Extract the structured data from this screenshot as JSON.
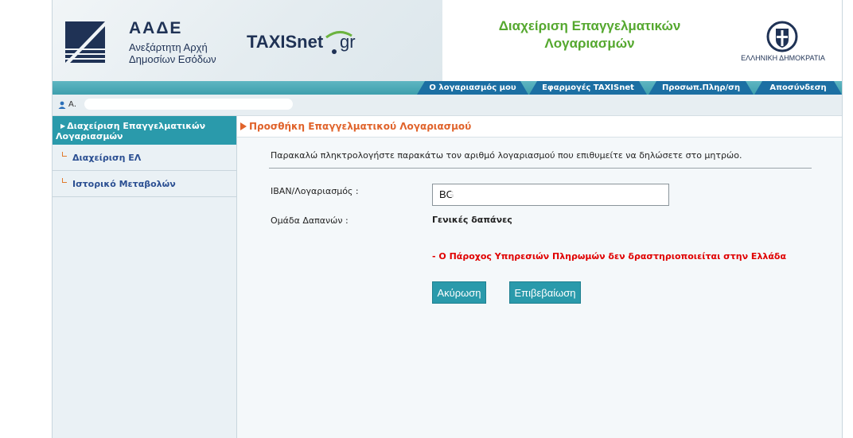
{
  "header": {
    "agency_acronym": "ΑΑΔΕ",
    "agency_name_line1": "Ανεξάρτητη Αρχή",
    "agency_name_line2": "Δημοσίων Εσόδων",
    "taxisnet_main": "TAXISnet",
    "taxisnet_suffix": "gr",
    "title_line1": "Διαχείριση Επαγγελματικών",
    "title_line2": "Λογαριασμών",
    "gov_label": "ΕΛΛΗΝΙΚΗ ΔΗΜΟΚΡΑΤΙΑ",
    "title_color": "#55a82f",
    "brand_color": "#1f3255"
  },
  "nav": {
    "items": [
      {
        "label": "Ο λογαριασμός μου"
      },
      {
        "label": "Εφαρμογές TAXISnet"
      },
      {
        "label": "Προσωπ.Πληρ/ση"
      },
      {
        "label": "Αποσύνδεση"
      }
    ],
    "tab_color": "#1c6fa3"
  },
  "user": {
    "name": "Α."
  },
  "sidebar": {
    "header": "Διαχείριση Επαγγελματικών Λογαριασμών",
    "items": [
      {
        "label": "Διαχείριση ΕΛ"
      },
      {
        "label": "Ιστορικό Μεταβολών"
      }
    ],
    "accent_color": "#2a9aab"
  },
  "main": {
    "section_title": "Προσθήκη Επαγγελματικού Λογαριασμού",
    "instructions": "Παρακαλώ πληκτρολογήστε παρακάτω τον αριθμό λογαριασμού που επιθυμείτε να δηλώσετε στο μητρώο.",
    "iban_label": "IBAN/Λογαριασμός :",
    "iban_value": "BG",
    "expense_group_label": "Ομάδα Δαπανών :",
    "expense_group_value": "Γενικές δαπάνες",
    "error_message": "- Ο Πάροχος Υπηρεσιών Πληρωμών δεν δραστηριοποιείται στην Ελλάδα",
    "cancel_label": "Ακύρωση",
    "confirm_label": "Επιβεβαίωση",
    "error_color": "#e00000",
    "title_color": "#e0632b"
  }
}
